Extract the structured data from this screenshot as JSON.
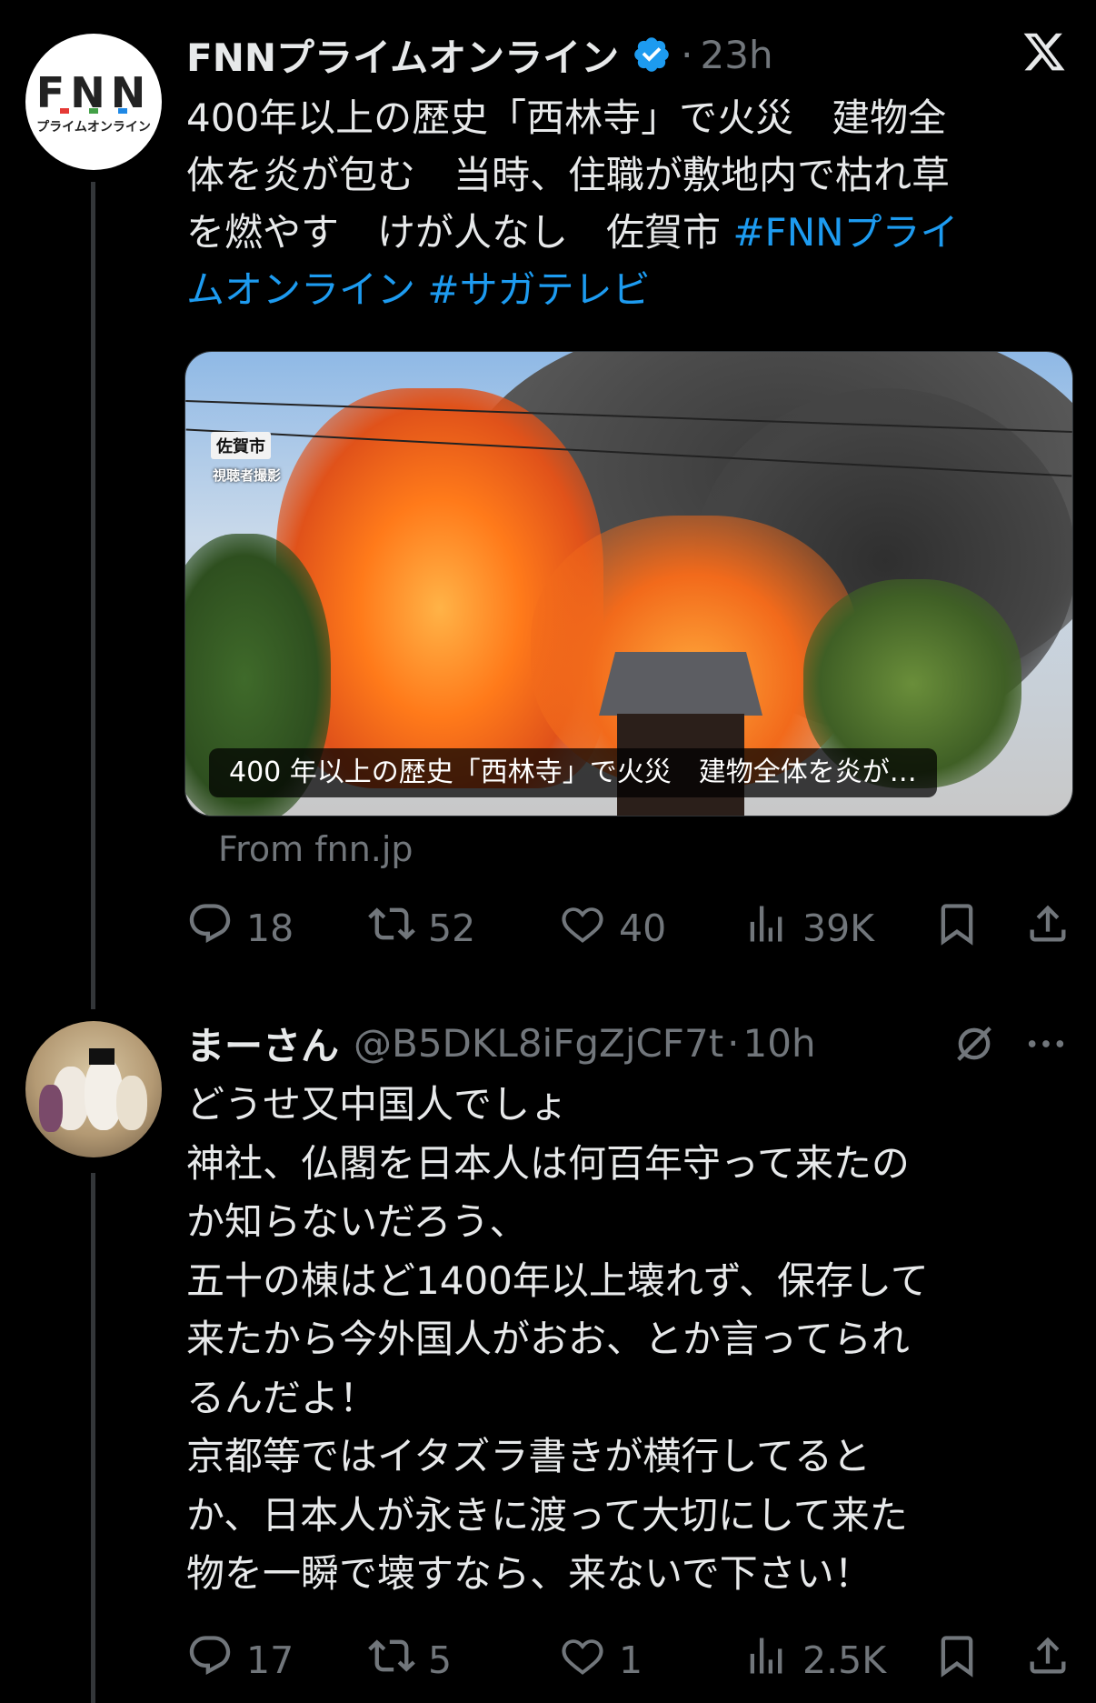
{
  "post1": {
    "display_name": "FNNプライムオンライン",
    "dot": "·",
    "time": "23h",
    "avatar_top_text": "FNN",
    "avatar_sub_text": "プライムオンライン",
    "text_lines": [
      "400年以上の歴史「西林寺」で火災　建物全",
      "体を炎が包む　当時、住職が敷地内で枯れ草",
      "を燃やす　けが人なし　佐賀市 "
    ],
    "hashtag_1a": "#FNNプライ",
    "hashtag_1b": "ムオンライン",
    "hashtag_2": "#サガテレビ",
    "media": {
      "overlay_city": "佐賀市",
      "overlay_credit": "視聴者撮影",
      "caption": "400 年以上の歴史「西林寺」で火災　建物全体を炎が…"
    },
    "source": "From fnn.jp",
    "stats": {
      "replies": "18",
      "reposts": "52",
      "likes": "40",
      "views": "39K"
    }
  },
  "post2": {
    "display_name": "まーさん",
    "handle": "@B5DKL8iFgZjCF7t",
    "dot": "·",
    "time": "10h",
    "text_lines": [
      "どうせ又中国人でしょ",
      "神社、仏閣を日本人は何百年守って来たの",
      "か知らないだろう、",
      "五十の棟はど1400年以上壊れず、保存して",
      "来たから今外国人がおお、とか言ってられ",
      "るんだよ！",
      "京都等ではイタズラ書きが横行してると",
      "か、日本人が永きに渡って大切にして来た",
      "物を一瞬で壊すなら、来ないで下さい！"
    ],
    "stats": {
      "replies": "17",
      "reposts": "5",
      "likes": "1",
      "views": "2.5K"
    }
  },
  "colors": {
    "background": "#000000",
    "text": "#e7e9ea",
    "secondary": "#71767b",
    "link": "#1d9bf0",
    "verified": "#1d9bf0"
  },
  "icons": [
    "x-logo-icon",
    "verified-badge-icon",
    "reply-icon",
    "repost-icon",
    "like-icon",
    "views-icon",
    "bookmark-icon",
    "share-icon",
    "grok-icon",
    "more-icon"
  ]
}
